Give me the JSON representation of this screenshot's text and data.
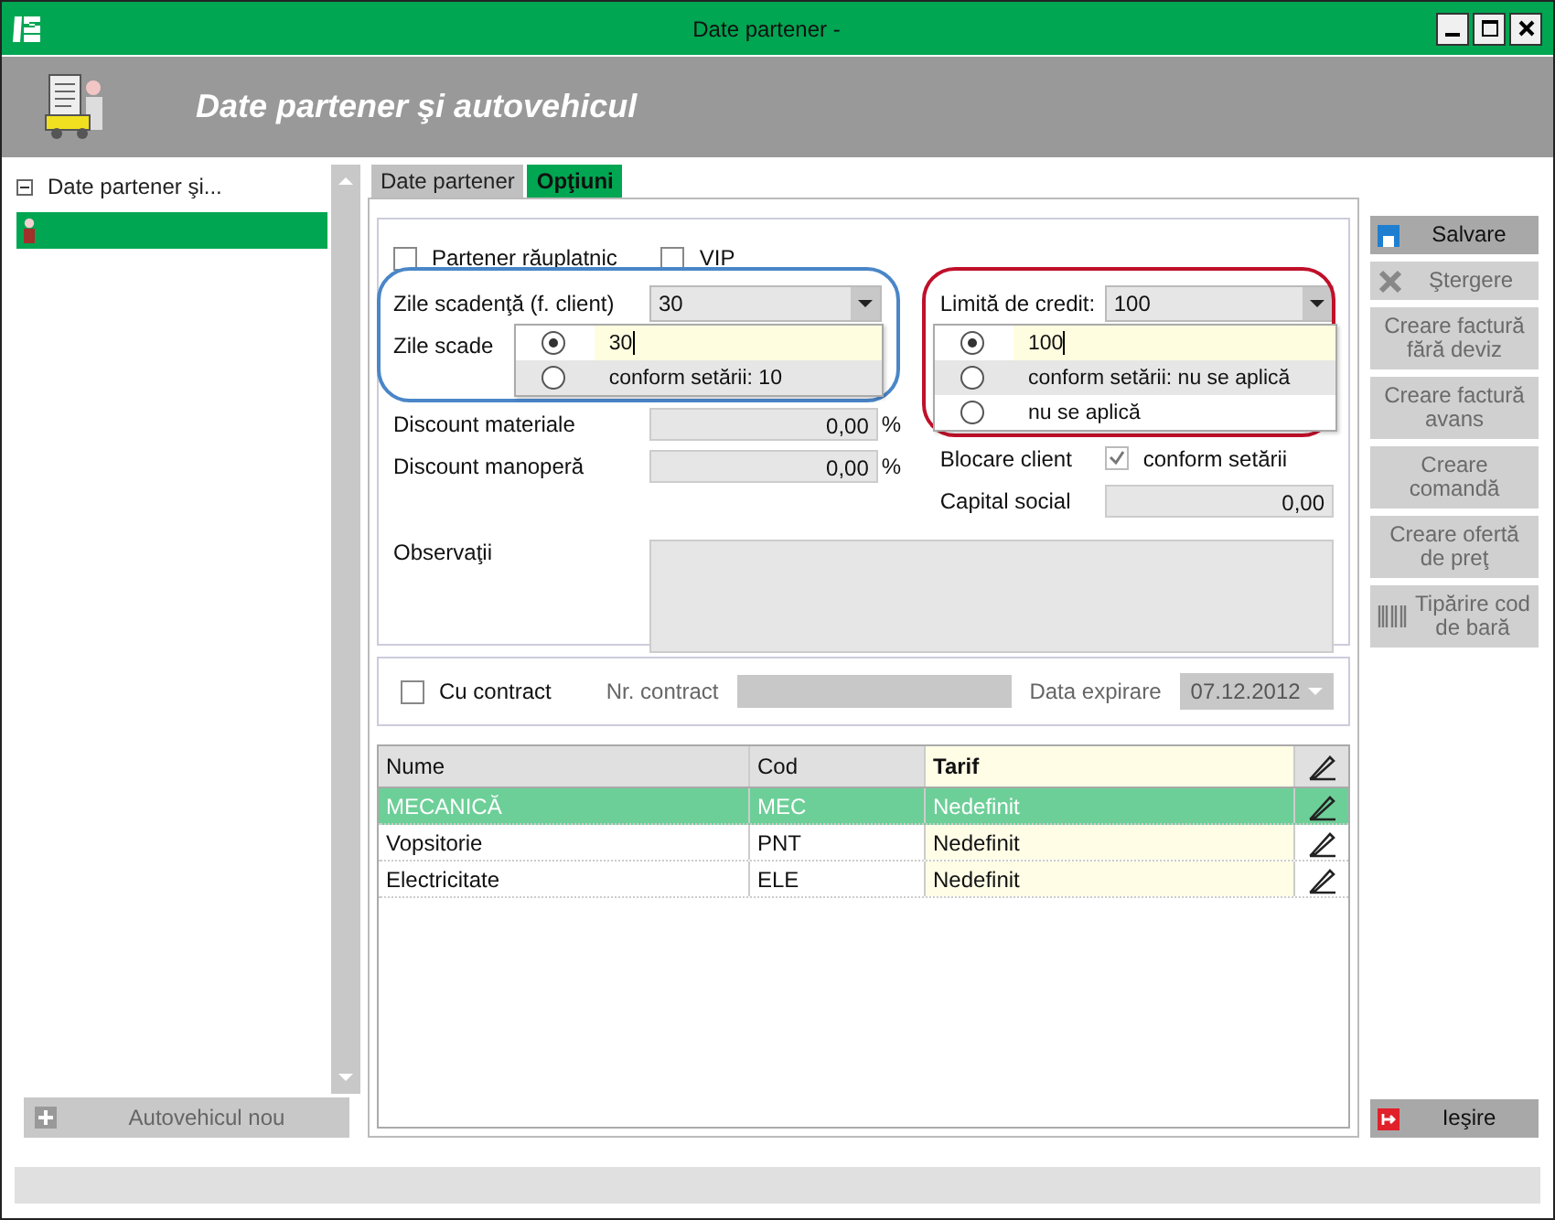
{
  "window": {
    "title": "Date partener -"
  },
  "header": {
    "title": "Date partener şi autovehicul"
  },
  "tree": {
    "items": [
      {
        "label": "Date partener şi...",
        "expanded": true,
        "selected": false,
        "children": [
          {
            "kind": "person",
            "selected": true
          }
        ]
      }
    ]
  },
  "add_vehicle_button": {
    "label": "Autovehicul nou",
    "disabled": true
  },
  "tabs": [
    {
      "label": "Date partener",
      "selected": false
    },
    {
      "label": "Opţiuni",
      "selected": true
    }
  ],
  "options": {
    "checkboxes": [
      {
        "label": "Partener răuplatnic",
        "checked": false
      },
      {
        "label": "VIP",
        "checked": false
      }
    ],
    "left_fields": [
      {
        "kind": "dropdown",
        "label": "Zile scadenţă (f. client)",
        "value": "30",
        "popup": [
          {
            "label": "30",
            "selected": true,
            "editing": true
          },
          {
            "label": "conform setării: 10",
            "selected": false,
            "editing": false
          }
        ]
      },
      {
        "kind": "label",
        "label": "Zile scade"
      },
      {
        "kind": "number",
        "label": "Discount materiale",
        "value": "0,00",
        "unit": "%"
      },
      {
        "kind": "number",
        "label": "Discount manoperă",
        "value": "0,00",
        "unit": "%"
      }
    ],
    "right_fields": [
      {
        "kind": "dropdown",
        "label": "Limită de credit:",
        "value": "100",
        "popup": [
          {
            "label": "100",
            "selected": true,
            "editing": true
          },
          {
            "label": "conform setării: nu se aplică",
            "selected": false,
            "editing": false
          },
          {
            "label": "nu se aplică",
            "selected": false,
            "editing": false
          }
        ]
      },
      {
        "kind": "check",
        "label": "Blocare client",
        "checked": true,
        "text": "conform setării"
      },
      {
        "kind": "number",
        "label": "Capital social",
        "value": "0,00"
      }
    ],
    "notes": {
      "label": "Observaţii"
    }
  },
  "callouts": [
    {
      "color": "#4a86c8"
    },
    {
      "color": "#c0102a"
    }
  ],
  "contract": {
    "checkbox": {
      "label": "Cu contract",
      "checked": false
    },
    "number_label": "Nr. contract",
    "expiry_label": "Data expirare",
    "expiry_value": "07.12.2012"
  },
  "grid": {
    "columns": [
      "Nume",
      "Cod",
      "Tarif"
    ],
    "rows": [
      {
        "cells": [
          "MECANICĂ",
          "MEC",
          "Nedefinit"
        ],
        "selected": true
      },
      {
        "cells": [
          "Vopsitorie",
          "PNT",
          "Nedefinit"
        ],
        "selected": false
      },
      {
        "cells": [
          "Electricitate",
          "ELE",
          "Nedefinit"
        ],
        "selected": false
      }
    ]
  },
  "side_buttons": [
    {
      "label": "Salvare",
      "kind": "save",
      "disabled": false
    },
    {
      "label": "Ştergere",
      "kind": "delete",
      "disabled": true
    },
    {
      "label": "Creare factură fără deviz",
      "kind": "text",
      "disabled": true
    },
    {
      "label": "Creare factură avans",
      "kind": "text",
      "disabled": true
    },
    {
      "label": "Creare comandă",
      "kind": "text",
      "disabled": true
    },
    {
      "label": "Creare ofertă de preţ",
      "kind": "text",
      "disabled": true
    },
    {
      "label": "Tipărire cod de bară",
      "kind": "barcode",
      "disabled": true
    }
  ],
  "exit_button": {
    "label": "Ieşire"
  }
}
